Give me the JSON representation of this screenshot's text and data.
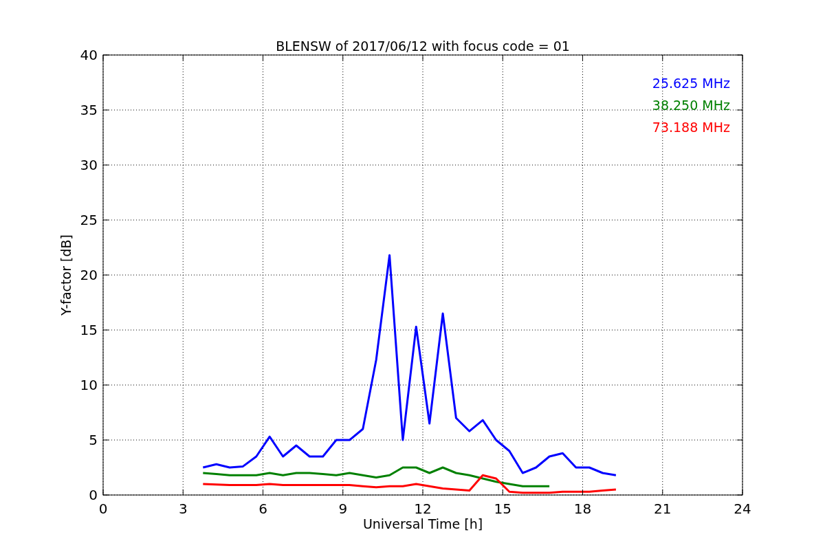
{
  "chart_data": {
    "type": "line",
    "title": "BLENSW of 2017/06/12 with focus code = 01",
    "xlabel": "Universal Time [h]",
    "ylabel": "Y-factor [dB]",
    "x": [
      3.75,
      4.25,
      4.75,
      5.25,
      5.75,
      6.25,
      6.75,
      7.25,
      7.75,
      8.25,
      8.75,
      9.25,
      9.75,
      10.25,
      10.75,
      11.25,
      11.75,
      12.25,
      12.75,
      13.25,
      13.75,
      14.25,
      14.75,
      15.25,
      15.75,
      16.25,
      16.75,
      17.25,
      17.75,
      18.25,
      18.75,
      19.25
    ],
    "series": [
      {
        "name": "25.625 MHz",
        "color": "#0000ff",
        "values": [
          2.5,
          2.8,
          2.5,
          2.6,
          3.5,
          5.3,
          3.5,
          4.5,
          3.5,
          3.5,
          5,
          5,
          6,
          12.3,
          21.8,
          5,
          15.3,
          6.5,
          16.5,
          7,
          5.8,
          6.8,
          5,
          4,
          2,
          2.5,
          3.5,
          3.8,
          2.5,
          2.5,
          2,
          1.8
        ]
      },
      {
        "name": "38.250 MHz",
        "color": "#008000",
        "values": [
          2,
          1.9,
          1.8,
          1.8,
          1.8,
          2,
          1.8,
          2,
          2,
          1.9,
          1.8,
          2,
          1.8,
          1.6,
          1.8,
          2.5,
          2.5,
          2,
          2.5,
          2,
          1.8,
          1.5,
          1.2,
          1,
          0.8,
          0.8,
          0.8,
          null,
          null,
          null,
          null,
          null
        ]
      },
      {
        "name": "73.188 MHz",
        "color": "#ff0000",
        "values": [
          1,
          0.95,
          0.9,
          0.9,
          0.9,
          1,
          0.9,
          0.9,
          0.9,
          0.9,
          0.9,
          0.9,
          0.8,
          0.7,
          0.8,
          0.8,
          1,
          0.8,
          0.6,
          0.5,
          0.4,
          1.8,
          1.5,
          0.3,
          0.2,
          0.2,
          0.2,
          0.3,
          0.3,
          0.3,
          0.4,
          0.5
        ]
      }
    ],
    "grid": true,
    "xlim": [
      0,
      24
    ],
    "ylim": [
      0,
      40
    ],
    "xticks": [
      0,
      3,
      6,
      9,
      12,
      15,
      18,
      21,
      24
    ],
    "yticks": [
      0,
      5,
      10,
      15,
      20,
      25,
      30,
      35,
      40
    ]
  }
}
